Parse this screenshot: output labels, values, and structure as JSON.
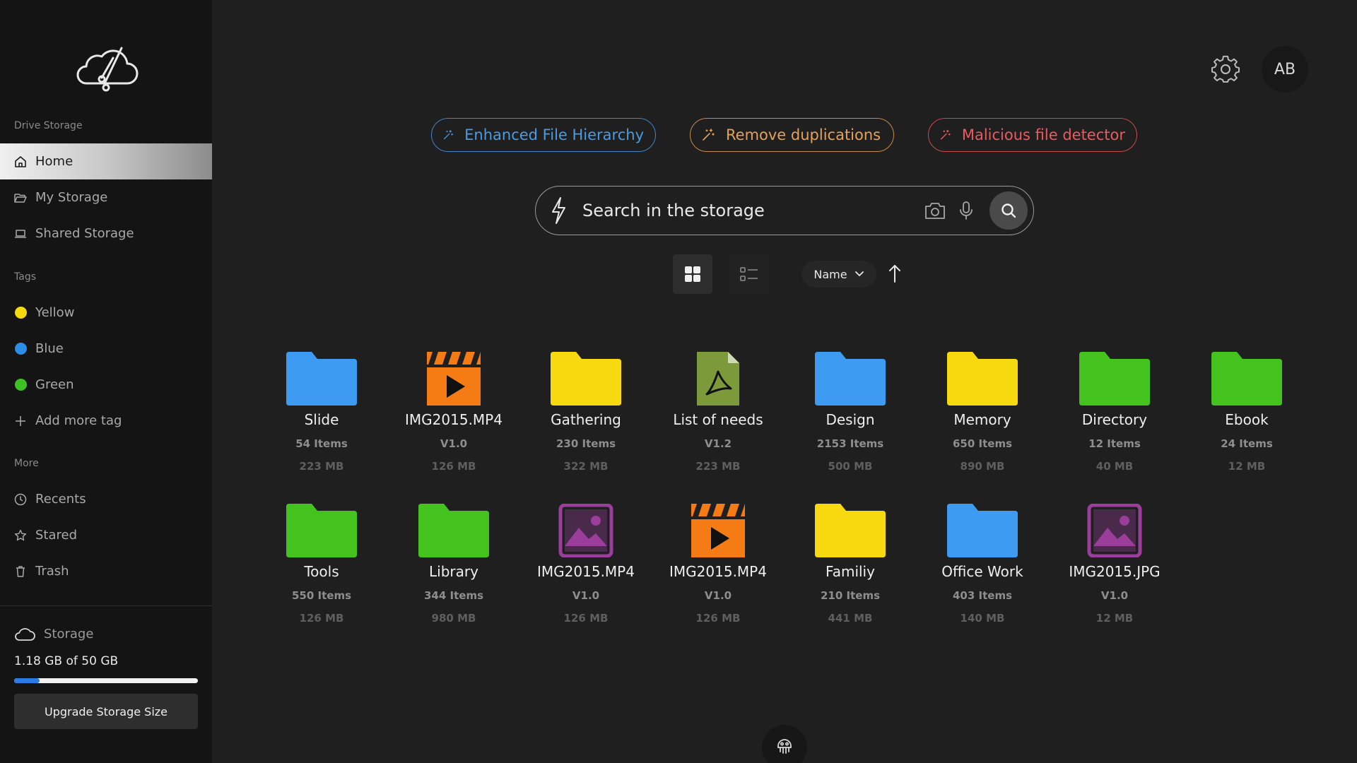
{
  "sidebar": {
    "drive_storage_label": "Drive Storage",
    "nav": [
      {
        "label": "Home",
        "icon": "home-icon",
        "active": true
      },
      {
        "label": "My Storage",
        "icon": "folder-open-icon"
      },
      {
        "label": "Shared Storage",
        "icon": "laptop-icon"
      }
    ],
    "tags_label": "Tags",
    "tags": [
      {
        "label": "Yellow",
        "color": "#f5d90f"
      },
      {
        "label": "Blue",
        "color": "#2b8de8"
      },
      {
        "label": "Green",
        "color": "#3fbf26"
      }
    ],
    "add_tag_label": "Add more tag",
    "more_label": "More",
    "more": [
      {
        "label": "Recents",
        "icon": "clock-icon"
      },
      {
        "label": "Stared",
        "icon": "star-icon"
      },
      {
        "label": "Trash",
        "icon": "trash-icon"
      }
    ],
    "storage": {
      "title": "Storage",
      "usage": "1.18 GB of 50 GB",
      "used_fraction": 0.14,
      "upgrade_label": "Upgrade Storage Size"
    }
  },
  "header": {
    "avatar_initials": "AB"
  },
  "features": {
    "hierarchy": "Enhanced File Hierarchy",
    "duplicates": "Remove duplications",
    "malicious": "Malicious file detector"
  },
  "search": {
    "placeholder": "Search in the storage"
  },
  "sort": {
    "field": "Name"
  },
  "colors": {
    "folder_blue": "#3d9bf2",
    "folder_yellow": "#f7d90f",
    "folder_green": "#44c21e",
    "video_orange": "#f57b15",
    "pdf_olive": "#7c9a3a",
    "image_purple": "#9b3e9b",
    "accent_blue": "#2a7be4"
  },
  "files": [
    {
      "name": "Slide",
      "meta1": "54 Items",
      "meta2": "223 MB",
      "icon": "folder-icon",
      "color": "#3d9bf2"
    },
    {
      "name": "IMG2015.MP4",
      "meta1": "V1.0",
      "meta2": "126 MB",
      "icon": "video-file-icon",
      "color": "#f57b15"
    },
    {
      "name": "Gathering",
      "meta1": "230 Items",
      "meta2": "322 MB",
      "icon": "folder-icon",
      "color": "#f7d90f"
    },
    {
      "name": "List of needs",
      "meta1": "V1.2",
      "meta2": "223 MB",
      "icon": "pdf-file-icon",
      "color": "#7c9a3a"
    },
    {
      "name": "Design",
      "meta1": "2153 Items",
      "meta2": "500 MB",
      "icon": "folder-icon",
      "color": "#3d9bf2"
    },
    {
      "name": "Memory",
      "meta1": "650 Items",
      "meta2": "890 MB",
      "icon": "folder-icon",
      "color": "#f7d90f"
    },
    {
      "name": "Directory",
      "meta1": "12 Items",
      "meta2": "40 MB",
      "icon": "folder-icon",
      "color": "#44c21e"
    },
    {
      "name": "Ebook",
      "meta1": "24 Items",
      "meta2": "12 MB",
      "icon": "folder-icon",
      "color": "#44c21e"
    },
    {
      "name": "Tools",
      "meta1": "550 Items",
      "meta2": "126 MB",
      "icon": "folder-icon",
      "color": "#44c21e"
    },
    {
      "name": "Library",
      "meta1": "344 Items",
      "meta2": "980 MB",
      "icon": "folder-icon",
      "color": "#44c21e"
    },
    {
      "name": "IMG2015.MP4",
      "meta1": "V1.0",
      "meta2": "126 MB",
      "icon": "image-file-icon",
      "color": "#9b3e9b"
    },
    {
      "name": "IMG2015.MP4",
      "meta1": "V1.0",
      "meta2": "126 MB",
      "icon": "video-file-icon",
      "color": "#f57b15"
    },
    {
      "name": "Familiy",
      "meta1": "210 Items",
      "meta2": "441 MB",
      "icon": "folder-icon",
      "color": "#f7d90f"
    },
    {
      "name": "Office Work",
      "meta1": "403 Items",
      "meta2": "140 MB",
      "icon": "folder-icon",
      "color": "#3d9bf2"
    },
    {
      "name": "IMG2015.JPG",
      "meta1": "V1.0",
      "meta2": "12 MB",
      "icon": "image-file-icon",
      "color": "#9b3e9b"
    }
  ]
}
